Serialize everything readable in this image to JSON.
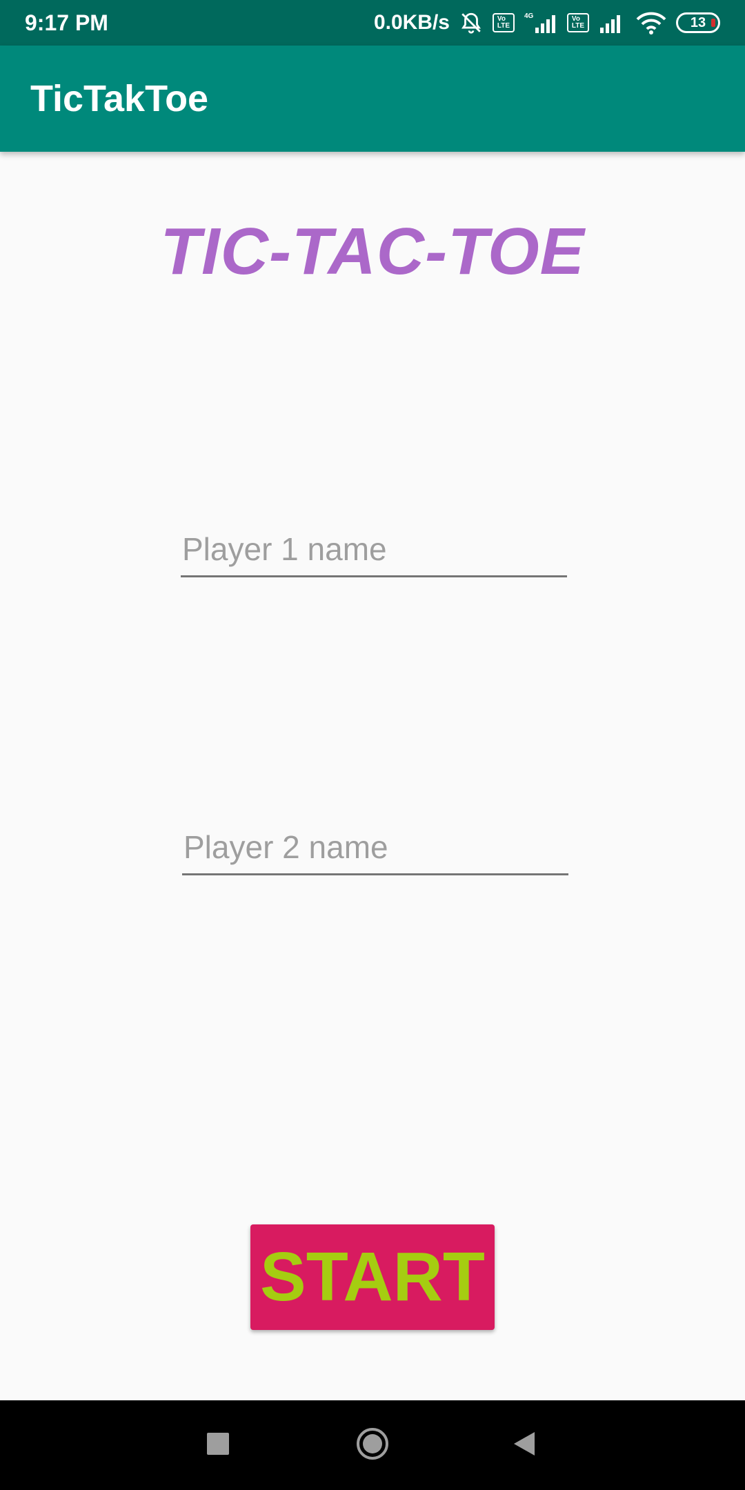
{
  "status_bar": {
    "time": "9:17 PM",
    "network_speed": "0.0KB/s",
    "volte_1": "Vo LTE",
    "network_type": "4G",
    "volte_2": "Vo LTE",
    "battery_level": "13"
  },
  "app_bar": {
    "title": "TicTakToe"
  },
  "main": {
    "game_title": "TIC-TAC-TOE",
    "player1": {
      "placeholder": "Player 1 name",
      "value": ""
    },
    "player2": {
      "placeholder": "Player 2 name",
      "value": ""
    },
    "start_label": "START"
  },
  "nav_bar": {
    "icons": [
      "recent-apps-icon",
      "home-icon",
      "back-icon"
    ]
  },
  "colors": {
    "status_bar": "#00695c",
    "app_bar": "#00897b",
    "title_purple": "#ab68c9",
    "start_bg": "#d81b60",
    "start_text": "#a5cd11"
  }
}
